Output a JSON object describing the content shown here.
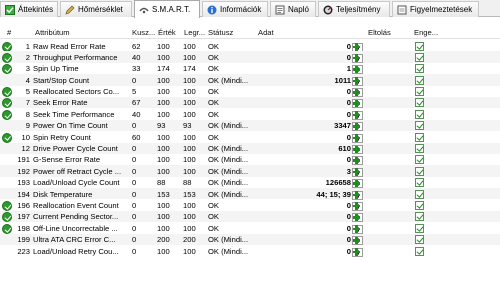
{
  "tabs": [
    {
      "label": "Áttekintés",
      "icon": "overview-icon",
      "active": false
    },
    {
      "label": "Hőmérséklet",
      "icon": "pencil-icon",
      "active": false
    },
    {
      "label": "S.M.A.R.T.",
      "icon": "smart-icon",
      "active": true
    },
    {
      "label": "Információk",
      "icon": "info-icon",
      "active": false
    },
    {
      "label": "Napló",
      "icon": "log-icon",
      "active": false
    },
    {
      "label": "Teljesítmény",
      "icon": "performance-icon",
      "active": false
    },
    {
      "label": "Figyelmeztetések",
      "icon": "alerts-icon",
      "active": false
    }
  ],
  "header": {
    "num": "#",
    "attribute": "Attribútum",
    "current": "Kusz...",
    "worst": "Érték",
    "threshold": "Legr...",
    "status": "Státusz",
    "data": "Adat",
    "offset": "Eltolás",
    "warning": "Enge..."
  },
  "colors": {
    "ok_icon": "#2b9a2b",
    "buttons": "#1e8f1e"
  },
  "rows": [
    {
      "num": "1",
      "ok": true,
      "attribute": "Raw Read Error Rate",
      "current": "62",
      "worst": "100",
      "threshold": "100",
      "status": "OK",
      "data": "0",
      "offset": "0"
    },
    {
      "num": "2",
      "ok": true,
      "attribute": "Throughput Performance",
      "current": "40",
      "worst": "100",
      "threshold": "100",
      "status": "OK",
      "data": "0",
      "offset": "0"
    },
    {
      "num": "3",
      "ok": true,
      "attribute": "Spin Up Time",
      "current": "33",
      "worst": "174",
      "threshold": "174",
      "status": "OK",
      "data": "1",
      "offset": "0"
    },
    {
      "num": "4",
      "ok": false,
      "attribute": "Start/Stop Count",
      "current": "0",
      "worst": "100",
      "threshold": "100",
      "status": "OK (Mindi...",
      "data": "1011",
      "offset": "0"
    },
    {
      "num": "5",
      "ok": true,
      "attribute": "Reallocated Sectors Co...",
      "current": "5",
      "worst": "100",
      "threshold": "100",
      "status": "OK",
      "data": "0",
      "offset": "0"
    },
    {
      "num": "7",
      "ok": true,
      "attribute": "Seek Error Rate",
      "current": "67",
      "worst": "100",
      "threshold": "100",
      "status": "OK",
      "data": "0",
      "offset": "0"
    },
    {
      "num": "8",
      "ok": true,
      "attribute": "Seek Time Performance",
      "current": "40",
      "worst": "100",
      "threshold": "100",
      "status": "OK",
      "data": "0",
      "offset": "0"
    },
    {
      "num": "9",
      "ok": false,
      "attribute": "Power On Time Count",
      "current": "0",
      "worst": "93",
      "threshold": "93",
      "status": "OK (Mindi...",
      "data": "3347",
      "offset": "0"
    },
    {
      "num": "10",
      "ok": true,
      "attribute": "Spin Retry Count",
      "current": "60",
      "worst": "100",
      "threshold": "100",
      "status": "OK",
      "data": "0",
      "offset": "0"
    },
    {
      "num": "12",
      "ok": false,
      "attribute": "Drive Power Cycle Count",
      "current": "0",
      "worst": "100",
      "threshold": "100",
      "status": "OK (Mindi...",
      "data": "610",
      "offset": "0"
    },
    {
      "num": "191",
      "ok": false,
      "attribute": "G-Sense Error Rate",
      "current": "0",
      "worst": "100",
      "threshold": "100",
      "status": "OK (Mindi...",
      "data": "0",
      "offset": "0"
    },
    {
      "num": "192",
      "ok": false,
      "attribute": "Power off Retract Cycle ...",
      "current": "0",
      "worst": "100",
      "threshold": "100",
      "status": "OK (Mindi...",
      "data": "3",
      "offset": "0"
    },
    {
      "num": "193",
      "ok": false,
      "attribute": "Load/Unload Cycle Count",
      "current": "0",
      "worst": "88",
      "threshold": "88",
      "status": "OK (Mindi...",
      "data": "126658",
      "offset": "0"
    },
    {
      "num": "194",
      "ok": false,
      "attribute": "Disk Temperature",
      "current": "0",
      "worst": "153",
      "threshold": "153",
      "status": "OK (Mindi...",
      "data": "44; 15; 39",
      "offset": "0"
    },
    {
      "num": "196",
      "ok": true,
      "attribute": "Reallocation Event Count",
      "current": "0",
      "worst": "100",
      "threshold": "100",
      "status": "OK",
      "data": "0",
      "offset": "0"
    },
    {
      "num": "197",
      "ok": true,
      "attribute": "Current Pending Sector...",
      "current": "0",
      "worst": "100",
      "threshold": "100",
      "status": "OK",
      "data": "0",
      "offset": "0"
    },
    {
      "num": "198",
      "ok": true,
      "attribute": "Off-Line Uncorrectable ...",
      "current": "0",
      "worst": "100",
      "threshold": "100",
      "status": "OK",
      "data": "0",
      "offset": "0"
    },
    {
      "num": "199",
      "ok": false,
      "attribute": "Ultra ATA CRC Error C...",
      "current": "0",
      "worst": "200",
      "threshold": "200",
      "status": "OK (Mindi...",
      "data": "0",
      "offset": "0"
    },
    {
      "num": "223",
      "ok": false,
      "attribute": "Load/Unload Retry Cou...",
      "current": "0",
      "worst": "100",
      "threshold": "100",
      "status": "OK (Mindi...",
      "data": "0",
      "offset": "0"
    }
  ]
}
